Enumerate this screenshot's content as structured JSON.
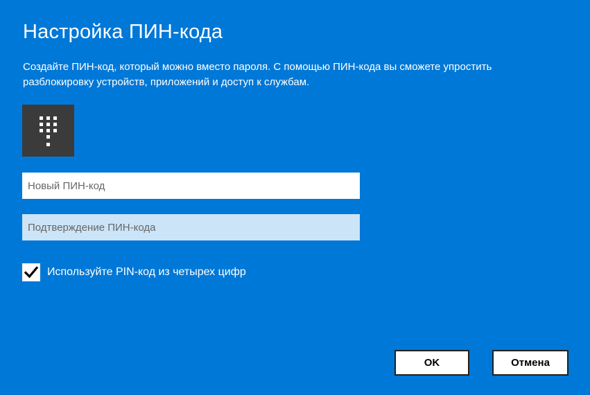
{
  "dialog": {
    "title": "Настройка ПИН-кода",
    "description": "Создайте ПИН-код, который можно вместо пароля. С помощью ПИН-кода вы сможете упростить разблокировку устройств, приложений и доступ к службам.",
    "pin_icon": "keypad-icon"
  },
  "fields": {
    "new_pin": {
      "placeholder": "Новый ПИН-код",
      "value": ""
    },
    "confirm_pin": {
      "placeholder": "Подтверждение ПИН-кода",
      "value": ""
    }
  },
  "checkbox": {
    "label": "Используйте PIN-код из четырех цифр",
    "checked": true
  },
  "buttons": {
    "ok_label": "OK",
    "cancel_label": "Отмена"
  },
  "colors": {
    "background": "#0078d7",
    "tile": "#3b3b3b",
    "confirm_field": "#cce4f7"
  }
}
